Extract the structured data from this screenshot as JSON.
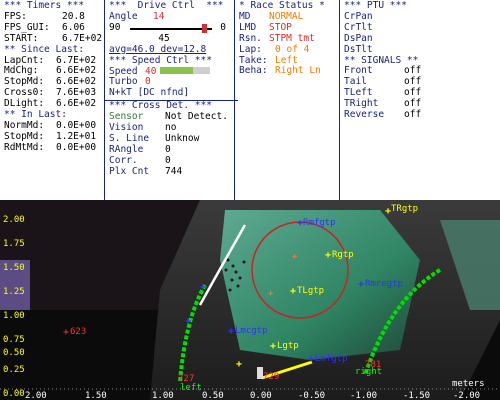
{
  "timers": {
    "header": "*** Timers ***",
    "rows": [
      {
        "k": "FPS:",
        "v": "20.8"
      },
      {
        "k": "FPS_GUI:",
        "v": "6.06"
      },
      {
        "k": "START:",
        "v": "6.7E+02"
      }
    ],
    "since_header": "** Since Last:",
    "since_rows": [
      {
        "k": "LapCnt:",
        "v": "6.7E+02"
      },
      {
        "k": "MdChg:",
        "v": "6.6E+02"
      },
      {
        "k": "StopMd:",
        "v": "6.6E+02"
      },
      {
        "k": "Cross0:",
        "v": "7.6E+03"
      },
      {
        "k": "DLight:",
        "v": "6.6E+02"
      }
    ],
    "inlast_header": "** In Last:",
    "inlast_rows": [
      {
        "k": "NormMd:",
        "v": "0.0E+00"
      },
      {
        "k": "StopMd:",
        "v": "1.2E+01"
      },
      {
        "k": "RdMtMd:",
        "v": "0.0E+00"
      }
    ]
  },
  "drive": {
    "header": "***  Drive Ctrl  ***",
    "angle_label": "Angle",
    "angle_value": "14",
    "slider_min": "90",
    "slider_max": "0",
    "slider_value": 0.1,
    "slider_caption": "45",
    "avg_dev": "avg=46.0  dev=12.8",
    "speed_header": "*** Speed Ctrl ***",
    "speed_label": "Speed",
    "speed_value": "40",
    "speed_fill": 0.65,
    "turbo_label": "Turbo",
    "turbo_value": "0",
    "nkt": "N+kT [DC nfnd]",
    "cross_header": "*** Cross Det. ***",
    "cross_rows": [
      {
        "k": "Sensor",
        "v": "Not Detect."
      },
      {
        "k": "Vision",
        "v": "no"
      },
      {
        "k": "S. Line",
        "v": "Unknow"
      },
      {
        "k": "RAngle",
        "v": "0"
      },
      {
        "k": "Corr.",
        "v": "0"
      },
      {
        "k": "Plx Cnt",
        "v": "744"
      }
    ]
  },
  "race": {
    "header": "* Race Status *",
    "rows": [
      {
        "k": "MD",
        "v": "NORMAL"
      },
      {
        "k": "LMD",
        "v": "STOP"
      },
      {
        "k": "Rsn.",
        "v": "STPM tmt"
      },
      {
        "k": "Lap:",
        "v": "0 of 4"
      },
      {
        "k": "Take:",
        "v": "Left"
      },
      {
        "k": "Beha:",
        "v": "Right Ln"
      }
    ]
  },
  "ptu": {
    "header": "*** PTU ***",
    "items": [
      "CrPan",
      "CrTlt",
      "DsPan",
      "DsTlt"
    ],
    "signals_header": "** SIGNALS **",
    "signals": [
      {
        "k": "Front",
        "v": "off"
      },
      {
        "k": "Tail",
        "v": "off"
      },
      {
        "k": "TLeft",
        "v": "off"
      },
      {
        "k": "TRight",
        "v": "off"
      },
      {
        "k": "Reverse",
        "v": "off"
      }
    ]
  },
  "scene": {
    "y_ticks": [
      "2.00",
      "1.75",
      "1.50",
      "1.25",
      "1.00",
      "0.75",
      "0.50",
      "0.25",
      "0.00"
    ],
    "x_ticks": [
      "2.00",
      "1.50",
      "1.00",
      "0.50",
      "0.00",
      "-0.50",
      "-1.00",
      "-1.50",
      "-2.00"
    ],
    "unit": "meters",
    "labels": {
      "rmfgtp": "Rmfgtp",
      "trgtp": "TRgtp",
      "rgtp": "Rgtp",
      "tlgtp": "TLgtp",
      "rmregtp": "Rmregtp",
      "lmcgtp": "Lmcgtp",
      "lgtp": "Lgtp",
      "lmfgtp": "Lmfgtp",
      "n623": "623",
      "n727": "727",
      "n729": "729",
      "n781": "781",
      "left": "left",
      "right": "right"
    },
    "colors": {
      "line": "#00e000",
      "target_blue": "#3030ff",
      "target_yellow": "#ffff00",
      "circle": "#cc2222"
    }
  }
}
